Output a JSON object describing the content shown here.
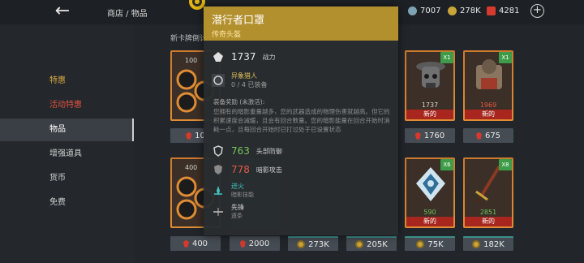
{
  "topbar": {
    "breadcrumb": "商店 / 物品",
    "currencies": [
      {
        "icon": "silver-icon",
        "value": "7007",
        "color": "#7fa3b3"
      },
      {
        "icon": "coin-icon",
        "value": "278K",
        "color": "#c9a53a"
      },
      {
        "icon": "gem-icon",
        "value": "4281",
        "color": "#d43a2e"
      }
    ]
  },
  "sidebar": {
    "items": [
      {
        "label": "特惠"
      },
      {
        "label": "活动特惠"
      },
      {
        "label": "物品"
      },
      {
        "label": "增强道具"
      },
      {
        "label": "货币"
      },
      {
        "label": "免费"
      }
    ]
  },
  "shop": {
    "section_title": "新卡牌倒计",
    "packs": [
      {
        "label": "100",
        "price": "10"
      },
      {
        "label": "400",
        "price": "400"
      }
    ],
    "row1": [
      {
        "power": "1737",
        "qty": "X1",
        "tag": "新的",
        "price": "1760"
      },
      {
        "power": "1969",
        "qty": "X1",
        "tag": "新的",
        "price": "675"
      }
    ],
    "row2": [
      {
        "power": "590",
        "qty": "X6",
        "tag": "新的",
        "price": "75K"
      },
      {
        "power": "2851",
        "qty": "X8",
        "tag": "新的",
        "price": "182K"
      }
    ],
    "row2_prices_left": [
      "2000",
      "273K",
      "205K"
    ]
  },
  "tooltip": {
    "title": "潜行者口罩",
    "subtitle": "传奇头盔",
    "power_value": "1737",
    "power_label": "战力",
    "set_name": "异象猎人",
    "set_count": "0 / 4 已装备",
    "set_bonus_title": "装备奖励 (未激活):",
    "set_bonus_text": "您拥有的暗影重量越多，您的武器造成的物理伤害就越高。但它的积累速度会减缓，且会有回合数量。您的暗影能量在回合开始时消耗一点，且每回合开始时已打过处于已设置状态",
    "stat1_value": "763",
    "stat1_label": "头部防御",
    "stat2_value": "778",
    "stat2_label": "暗影攻击",
    "skill_name": "迸火",
    "skill_sub": "暗影技能",
    "perk_name": "先锋",
    "perk_sub": "遗条"
  }
}
